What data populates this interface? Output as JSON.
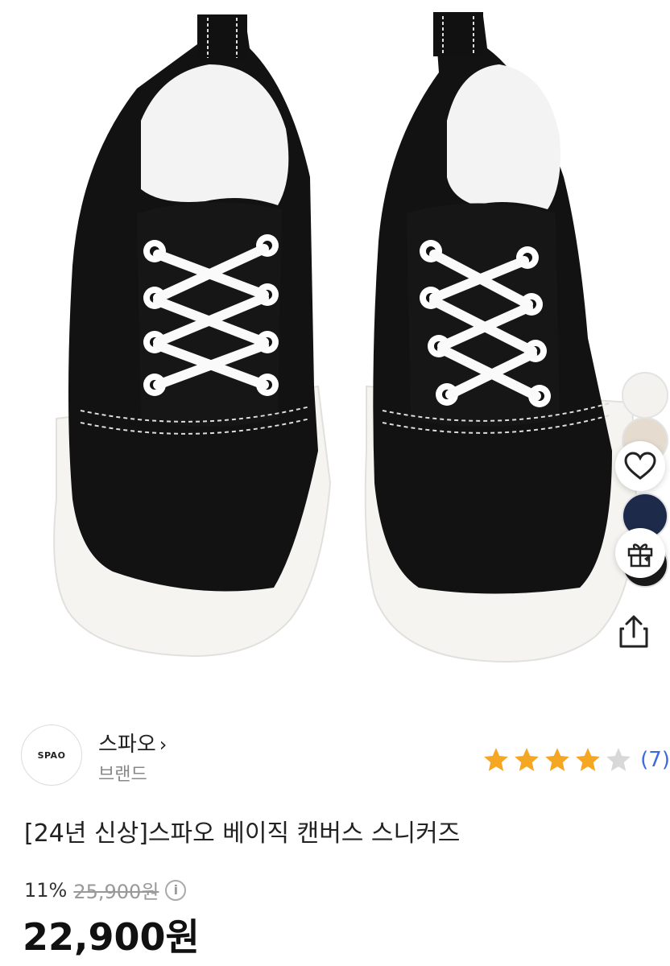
{
  "brand": {
    "logo_text": "SPAO",
    "name": "스파오",
    "chevron": "›",
    "sub_label": "브랜드"
  },
  "rating": {
    "stars": 4,
    "max_stars": 5,
    "count_text": "(7)"
  },
  "product": {
    "title": "[24년 신상]스파오 베이직 캔버스 스니커즈"
  },
  "price": {
    "discount_rate": "11%",
    "original_price": "25,900원",
    "sale_price": "22,900원"
  },
  "side_actions": {
    "icons": [
      "heart-icon",
      "gift-icon",
      "share-icon"
    ]
  },
  "swatches": [
    "#f4f2ee",
    "#e5dccf",
    "#1d2a4a",
    "#1a1a1a"
  ],
  "colors": {
    "star_fill": "#f5a623",
    "star_empty": "#d8d8d8",
    "link": "#3e6ae1"
  }
}
